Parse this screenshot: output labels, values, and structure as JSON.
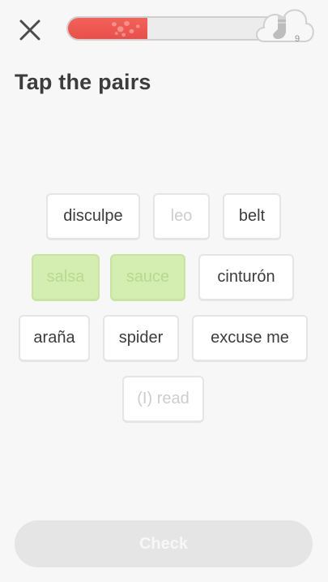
{
  "header": {
    "close_icon": "close-x-icon",
    "progress": {
      "fraction": 0.38,
      "color": "#ef5b52"
    },
    "streak": {
      "icon": "sock-icon",
      "count": "9"
    }
  },
  "prompt": {
    "title": "Tap the pairs"
  },
  "tiles": [
    {
      "label": "disculpe",
      "state": "available"
    },
    {
      "label": "leo",
      "state": "used"
    },
    {
      "label": "belt",
      "state": "available"
    },
    {
      "label": "salsa",
      "state": "matched"
    },
    {
      "label": "sauce",
      "state": "matched"
    },
    {
      "label": "cinturón",
      "state": "available"
    },
    {
      "label": "araña",
      "state": "available"
    },
    {
      "label": "spider",
      "state": "available"
    },
    {
      "label": "excuse me",
      "state": "available"
    },
    {
      "label": "(I) read",
      "state": "used"
    }
  ],
  "footer": {
    "check_label": "Check",
    "enabled": false
  },
  "colors": {
    "background": "#f7f7f7",
    "matched_fill": "#d4edb0",
    "used_text": "#cdcdcd",
    "button_disabled": "#e5e5e5"
  }
}
